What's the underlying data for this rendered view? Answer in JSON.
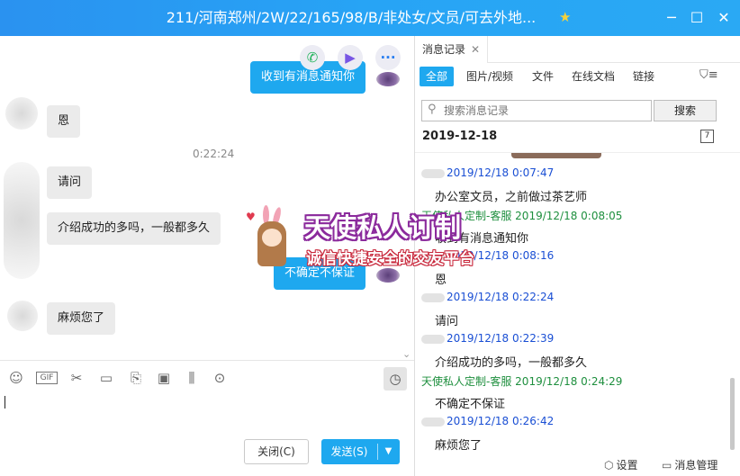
{
  "window": {
    "title": "211/河南郑州/2W/22/165/98/B/非处女/文员/可去外地...",
    "min_icon": "minimize-icon",
    "max_icon": "maximize-icon",
    "close_icon": "close-icon"
  },
  "chat": {
    "messages": [
      {
        "dir": "out",
        "text": "收到有消息通知你"
      },
      {
        "dir": "in",
        "text": "恩"
      },
      {
        "dir": "time",
        "text": "0:22:24"
      },
      {
        "dir": "in",
        "text": "请问"
      },
      {
        "dir": "in",
        "text": "介绍成功的多吗，一般都多久"
      },
      {
        "dir": "out",
        "text": "不确定不保证"
      },
      {
        "dir": "in",
        "text": "麻烦您了"
      }
    ],
    "toolbar_icons": [
      "emoji-icon",
      "gif-icon",
      "scissors-icon",
      "folder-icon",
      "file-share-icon",
      "image-icon",
      "shake-icon",
      "more-icon"
    ],
    "gif_label": "GIF",
    "close_label": "关闭(C)",
    "send_label": "发送(S)"
  },
  "history": {
    "tab_label": "消息记录",
    "filters": [
      "全部",
      "图片/视频",
      "文件",
      "在线文档",
      "链接"
    ],
    "active_filter": "全部",
    "search_placeholder": "搜索消息记录",
    "search_button": "搜索",
    "date": "2019-12-18",
    "entries": [
      {
        "sender": "",
        "time": "2019/12/18 0:07:47",
        "color": "blue",
        "text": "办公室文员，之前做过茶艺师"
      },
      {
        "sender": "天使私人定制-客服",
        "time": "2019/12/18 0:08:05",
        "color": "green",
        "text": "收到有消息通知你"
      },
      {
        "sender": "",
        "time": "2019/12/18 0:08:16",
        "color": "blue",
        "text": "恩"
      },
      {
        "sender": "",
        "time": "2019/12/18 0:22:24",
        "color": "blue",
        "text": "请问"
      },
      {
        "sender": "",
        "time": "2019/12/18 0:22:39",
        "color": "blue",
        "text": "介绍成功的多吗，一般都多久"
      },
      {
        "sender": "天使私人定制-客服",
        "time": "2019/12/18 0:24:29",
        "color": "green",
        "text": "不确定不保证"
      },
      {
        "sender": "",
        "time": "2019/12/18 0:26:42",
        "color": "blue",
        "text": "麻烦您了"
      }
    ],
    "footer": {
      "settings": "设置",
      "manage": "消息管理"
    }
  },
  "watermark": {
    "title": "天使私人订制",
    "subtitle": "诚信快捷安全的交友平台"
  },
  "colors": {
    "accent": "#1ea8ef",
    "timestamp_blue": "#1a4fd4",
    "timestamp_green": "#1e8f3e"
  }
}
